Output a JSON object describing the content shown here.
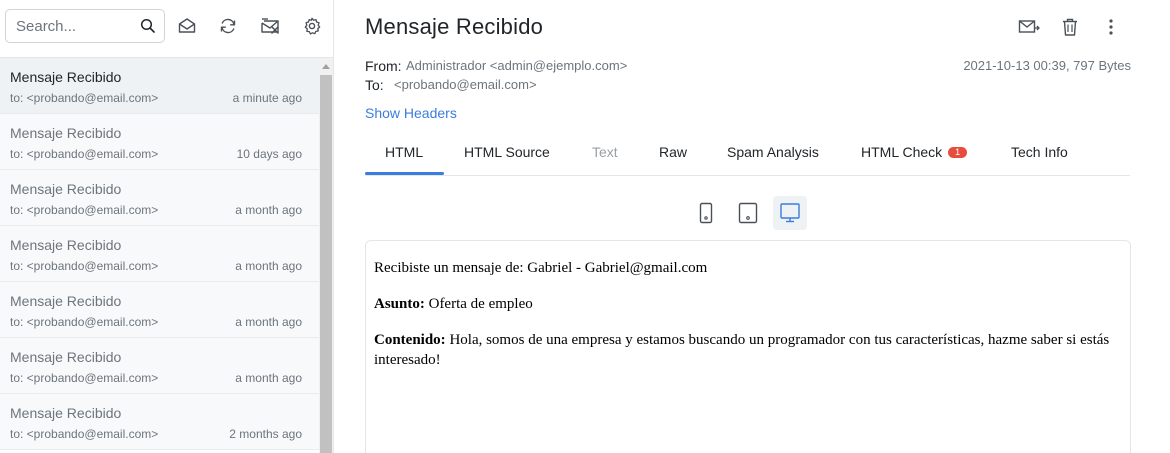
{
  "sidebar": {
    "search": {
      "placeholder": "Search..."
    },
    "toolbar": [
      {
        "name": "mark-read",
        "icon": "envelope-open-icon"
      },
      {
        "name": "refresh",
        "icon": "refresh-icon"
      },
      {
        "name": "delete-all",
        "icon": "mailbox-clear-icon"
      },
      {
        "name": "settings",
        "icon": "gear-icon"
      }
    ],
    "messages": [
      {
        "subject": "Mensaje Recibido",
        "to": "to: <probando@email.com>",
        "time": "a minute ago"
      },
      {
        "subject": "Mensaje Recibido",
        "to": "to: <probando@email.com>",
        "time": "10 days ago"
      },
      {
        "subject": "Mensaje Recibido",
        "to": "to: <probando@email.com>",
        "time": "a month ago"
      },
      {
        "subject": "Mensaje Recibido",
        "to": "to: <probando@email.com>",
        "time": "a month ago"
      },
      {
        "subject": "Mensaje Recibido",
        "to": "to: <probando@email.com>",
        "time": "a month ago"
      },
      {
        "subject": "Mensaje Recibido",
        "to": "to: <probando@email.com>",
        "time": "a month ago"
      },
      {
        "subject": "Mensaje Recibido",
        "to": "to: <probando@email.com>",
        "time": "2 months ago"
      }
    ]
  },
  "message": {
    "title": "Mensaje Recibido",
    "from_label": "From:",
    "from_value": "Administrador <admin@ejemplo.com>",
    "to_label": "To:",
    "to_value": "<probando@email.com>",
    "meta": "2021-10-13 00:39, 797 Bytes",
    "show_headers": "Show Headers"
  },
  "tabs": [
    {
      "label": "HTML",
      "active": true
    },
    {
      "label": "HTML Source"
    },
    {
      "label": "Text",
      "disabled": true
    },
    {
      "label": "Raw"
    },
    {
      "label": "Spam Analysis"
    },
    {
      "label": "HTML Check",
      "badge": "1"
    },
    {
      "label": "Tech Info"
    }
  ],
  "colors": {
    "accent": "#3b7ddd",
    "badge": "#e74c3c"
  },
  "body": {
    "line1": "Recibiste un mensaje de: Gabriel - Gabriel@gmail.com",
    "asunto_label": "Asunto:",
    "asunto_value": "Oferta de empleo",
    "contenido_label": "Contenido:",
    "contenido_value": "Hola, somos de una empresa y estamos buscando un programador con tus características, hazme saber si estás interesado!"
  }
}
